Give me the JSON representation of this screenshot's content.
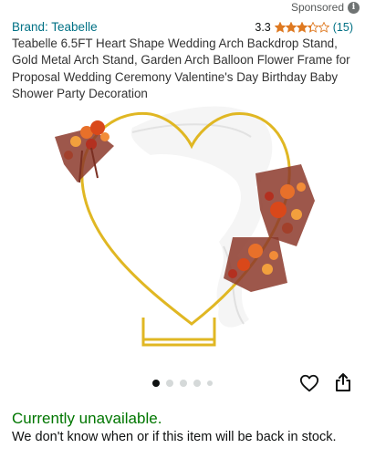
{
  "sponsored": {
    "label": "Sponsored",
    "icon": "info-icon"
  },
  "product": {
    "brand": "Brand: Teabelle",
    "rating": {
      "value": "3.3",
      "stars": 3.3,
      "max_stars": 5,
      "count": "(15)"
    },
    "title": "Teabelle 6.5FT Heart Shape Wedding Arch Backdrop Stand, Gold Metal Arch Stand, Garden Arch Balloon Flower Frame for Proposal Wedding Ceremony Valentine's Day Birthday Baby Shower Party Decoration",
    "image_alt": "gold heart-shaped metal arch with orange and burgundy flowers and white drape"
  },
  "carousel": {
    "dot_count": 5,
    "active_index": 0
  },
  "actions": {
    "wishlist_icon": "heart-icon",
    "share_icon": "share-icon"
  },
  "availability": {
    "status": "Currently unavailable.",
    "note": "We don't know when or if this item will be back in stock."
  },
  "colors": {
    "link": "#007185",
    "star": "#de7921",
    "in_stock_green": "#007600",
    "arch_gold": "#e0b723"
  }
}
